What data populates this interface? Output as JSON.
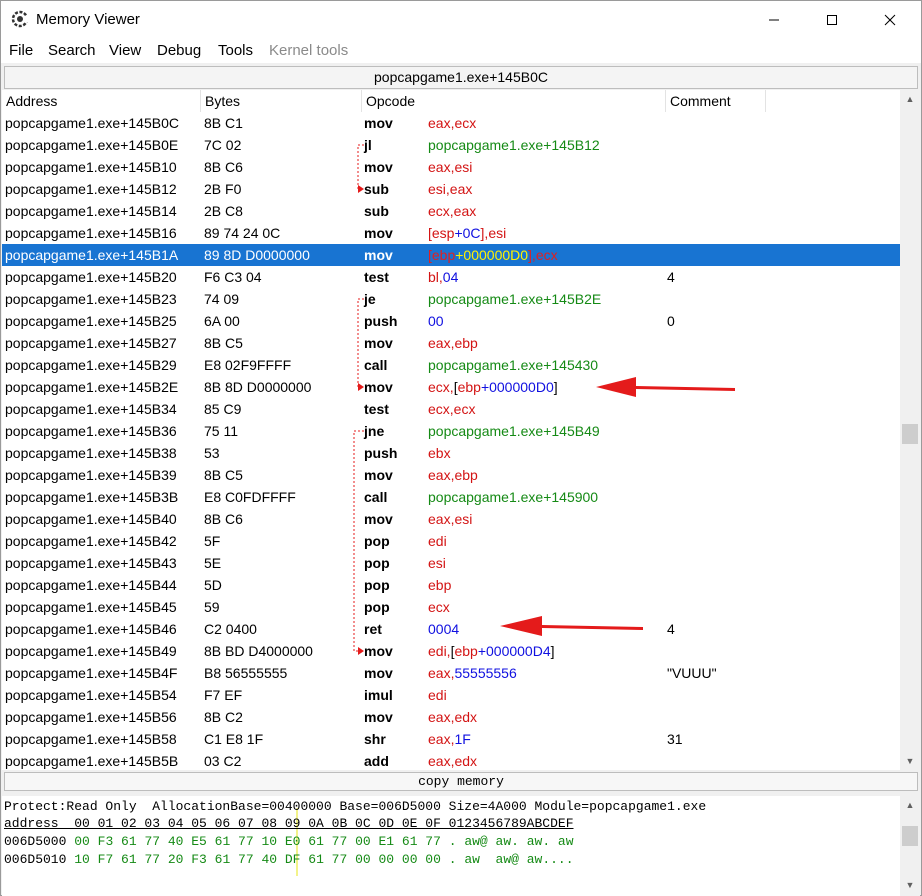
{
  "window": {
    "title": "Memory Viewer"
  },
  "menu": [
    "File",
    "Search",
    "View",
    "Debug",
    "Tools",
    "Kernel tools"
  ],
  "address_bar": "popcapgame1.exe+145B0C",
  "columns": [
    "Address",
    "Bytes",
    "Opcode",
    "Comment"
  ],
  "rows": [
    {
      "addr": "popcapgame1.exe+145B0C",
      "bytes": "8B C1",
      "op": "mov",
      "args": [
        [
          "r",
          "eax,ecx"
        ]
      ],
      "comment": ""
    },
    {
      "addr": "popcapgame1.exe+145B0E",
      "bytes": "7C 02",
      "op": "jl",
      "args": [
        [
          "g",
          "popcapgame1.exe+145B12"
        ]
      ],
      "comment": ""
    },
    {
      "addr": "popcapgame1.exe+145B10",
      "bytes": "8B C6",
      "op": "mov",
      "args": [
        [
          "r",
          "eax,esi"
        ]
      ],
      "comment": ""
    },
    {
      "addr": "popcapgame1.exe+145B12",
      "bytes": "2B F0",
      "op": "sub",
      "args": [
        [
          "r",
          "esi,eax"
        ]
      ],
      "comment": ""
    },
    {
      "addr": "popcapgame1.exe+145B14",
      "bytes": "2B C8",
      "op": "sub",
      "args": [
        [
          "r",
          "ecx,eax"
        ]
      ],
      "comment": ""
    },
    {
      "addr": "popcapgame1.exe+145B16",
      "bytes": "89 74 24 0C",
      "op": "mov",
      "args": [
        [
          "r",
          "[esp"
        ],
        [
          "b",
          "+0C"
        ],
        [
          "r",
          "],esi"
        ]
      ],
      "comment": ""
    },
    {
      "addr": "popcapgame1.exe+145B1A",
      "bytes": "89 8D D0000000",
      "op": "mov",
      "args": [
        [
          "r",
          "[ebp"
        ],
        [
          "b",
          "+000000D0"
        ],
        [
          "r",
          "],ecx"
        ]
      ],
      "comment": "",
      "selected": true
    },
    {
      "addr": "popcapgame1.exe+145B20",
      "bytes": "F6 C3 04",
      "op": "test",
      "args": [
        [
          "r",
          "bl,"
        ],
        [
          "b",
          "04"
        ]
      ],
      "comment": "4"
    },
    {
      "addr": "popcapgame1.exe+145B23",
      "bytes": "74 09",
      "op": "je",
      "args": [
        [
          "g",
          "popcapgame1.exe+145B2E"
        ]
      ],
      "comment": ""
    },
    {
      "addr": "popcapgame1.exe+145B25",
      "bytes": "6A 00",
      "op": "push",
      "args": [
        [
          "b",
          "00"
        ]
      ],
      "comment": "0"
    },
    {
      "addr": "popcapgame1.exe+145B27",
      "bytes": "8B C5",
      "op": "mov",
      "args": [
        [
          "r",
          "eax,ebp"
        ]
      ],
      "comment": ""
    },
    {
      "addr": "popcapgame1.exe+145B29",
      "bytes": "E8 02F9FFFF",
      "op": "call",
      "args": [
        [
          "g",
          "popcapgame1.exe+145430"
        ]
      ],
      "comment": ""
    },
    {
      "addr": "popcapgame1.exe+145B2E",
      "bytes": "8B 8D D0000000",
      "op": "mov",
      "args": [
        [
          "r",
          "ecx,"
        ],
        [
          "k",
          "["
        ],
        [
          "r",
          "ebp"
        ],
        [
          "b",
          "+000000D0"
        ],
        [
          "k",
          "]"
        ]
      ],
      "comment": ""
    },
    {
      "addr": "popcapgame1.exe+145B34",
      "bytes": "85 C9",
      "op": "test",
      "args": [
        [
          "r",
          "ecx,ecx"
        ]
      ],
      "comment": ""
    },
    {
      "addr": "popcapgame1.exe+145B36",
      "bytes": "75 11",
      "op": "jne",
      "args": [
        [
          "g",
          "popcapgame1.exe+145B49"
        ]
      ],
      "comment": ""
    },
    {
      "addr": "popcapgame1.exe+145B38",
      "bytes": "53",
      "op": "push",
      "args": [
        [
          "r",
          "ebx"
        ]
      ],
      "comment": ""
    },
    {
      "addr": "popcapgame1.exe+145B39",
      "bytes": "8B C5",
      "op": "mov",
      "args": [
        [
          "r",
          "eax,ebp"
        ]
      ],
      "comment": ""
    },
    {
      "addr": "popcapgame1.exe+145B3B",
      "bytes": "E8 C0FDFFFF",
      "op": "call",
      "args": [
        [
          "g",
          "popcapgame1.exe+145900"
        ]
      ],
      "comment": ""
    },
    {
      "addr": "popcapgame1.exe+145B40",
      "bytes": "8B C6",
      "op": "mov",
      "args": [
        [
          "r",
          "eax,esi"
        ]
      ],
      "comment": ""
    },
    {
      "addr": "popcapgame1.exe+145B42",
      "bytes": "5F",
      "op": "pop",
      "args": [
        [
          "r",
          "edi"
        ]
      ],
      "comment": ""
    },
    {
      "addr": "popcapgame1.exe+145B43",
      "bytes": "5E",
      "op": "pop",
      "args": [
        [
          "r",
          "esi"
        ]
      ],
      "comment": ""
    },
    {
      "addr": "popcapgame1.exe+145B44",
      "bytes": "5D",
      "op": "pop",
      "args": [
        [
          "r",
          "ebp"
        ]
      ],
      "comment": ""
    },
    {
      "addr": "popcapgame1.exe+145B45",
      "bytes": "59",
      "op": "pop",
      "args": [
        [
          "r",
          "ecx"
        ]
      ],
      "comment": ""
    },
    {
      "addr": "popcapgame1.exe+145B46",
      "bytes": "C2 0400",
      "op": "ret",
      "args": [
        [
          "b",
          "0004"
        ]
      ],
      "comment": "4"
    },
    {
      "addr": "popcapgame1.exe+145B49",
      "bytes": "8B BD D4000000",
      "op": "mov",
      "args": [
        [
          "r",
          "edi,"
        ],
        [
          "k",
          "["
        ],
        [
          "r",
          "ebp"
        ],
        [
          "b",
          "+000000D4"
        ],
        [
          "k",
          "]"
        ]
      ],
      "comment": ""
    },
    {
      "addr": "popcapgame1.exe+145B4F",
      "bytes": "B8 56555555",
      "op": "mov",
      "args": [
        [
          "r",
          "eax,"
        ],
        [
          "b",
          "55555556"
        ]
      ],
      "comment": "\"VUUU\""
    },
    {
      "addr": "popcapgame1.exe+145B54",
      "bytes": "F7 EF",
      "op": "imul",
      "args": [
        [
          "r",
          "edi"
        ]
      ],
      "comment": ""
    },
    {
      "addr": "popcapgame1.exe+145B56",
      "bytes": "8B C2",
      "op": "mov",
      "args": [
        [
          "r",
          "eax,edx"
        ]
      ],
      "comment": ""
    },
    {
      "addr": "popcapgame1.exe+145B58",
      "bytes": "C1 E8 1F",
      "op": "shr",
      "args": [
        [
          "r",
          "eax,"
        ],
        [
          "b",
          "1F"
        ]
      ],
      "comment": "31"
    },
    {
      "addr": "popcapgame1.exe+145B5B",
      "bytes": "03 C2",
      "op": "add",
      "args": [
        [
          "r",
          "eax,edx"
        ]
      ],
      "comment": ""
    }
  ],
  "copy_memory_label": "copy memory",
  "hex": {
    "info": "Protect:Read Only  AllocationBase=00400000 Base=006D5000 Size=4A000 Module=popcapgame1.exe",
    "header": "address  00 01 02 03 04 05 06 07 08 09 0A 0B 0C 0D 0E 0F 0123456789ABCDEF",
    "lines": [
      {
        "addr": "006D5000",
        "bytes": "00 F3 61 77 40 E5 61 77 10 E0 61 77 00 E1 61 77",
        "ascii": ". aw@ aw. aw. aw"
      },
      {
        "addr": "006D5010",
        "bytes": "10 F7 61 77 20 F3 61 77 40 DF 61 77 00 00 00 00",
        "ascii": ". aw  aw@ aw...."
      }
    ]
  },
  "colors": {
    "selection": "#1874d2",
    "register": "#d31414",
    "address": "#158a15",
    "number": "#1010e0",
    "annotation_arrow": "#e41b1b"
  }
}
